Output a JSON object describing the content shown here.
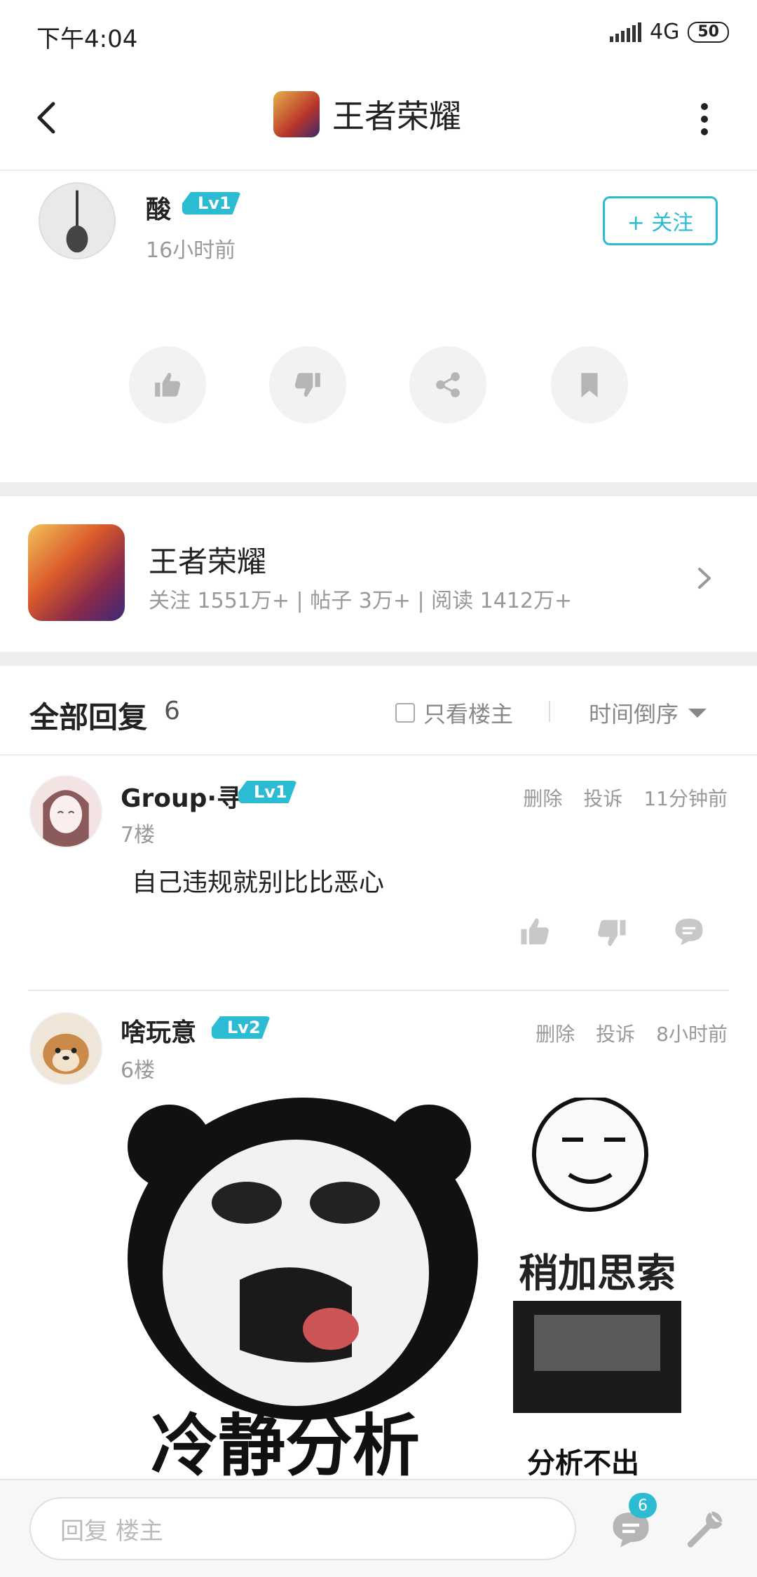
{
  "status_bar": {
    "time": "下午4:04",
    "network": "4G",
    "battery": "50"
  },
  "nav": {
    "title": "王者荣耀"
  },
  "post": {
    "author_name": "酸",
    "author_level": "Lv1",
    "time": "16小时前",
    "follow_label": "+ 关注"
  },
  "forum": {
    "name": "王者荣耀",
    "stats": "关注 1551万+ | 帖子 3万+ | 阅读 1412万+"
  },
  "replies_header": {
    "title": "全部回复",
    "count": "6",
    "only_host_label": "只看楼主",
    "sort_label": "时间倒序"
  },
  "comments": [
    {
      "name": "Group·寻",
      "level": "Lv1",
      "floor": "7楼",
      "delete_label": "删除",
      "report_label": "投诉",
      "time": "11分钟前",
      "text": "自己违规就别比比恶心"
    },
    {
      "name": "啥玩意",
      "level": "Lv2",
      "floor": "6楼",
      "delete_label": "删除",
      "report_label": "投诉",
      "time": "8小时前",
      "meme_text_main": "冷静分析",
      "meme_text_top": "稍加思索",
      "meme_text_bottom": "分析不出"
    }
  ],
  "bottom_bar": {
    "placeholder": "回复  楼主",
    "message_count": "6"
  },
  "colors": {
    "accent": "#2bbcd3",
    "icon_gray": "#b5b5b5"
  },
  "icons": [
    "back-icon",
    "more-icon",
    "thumbs-up-icon",
    "thumbs-down-icon",
    "share-icon",
    "bookmark-icon",
    "chevron-right-icon",
    "comment-icon",
    "message-icon",
    "wrench-icon"
  ]
}
